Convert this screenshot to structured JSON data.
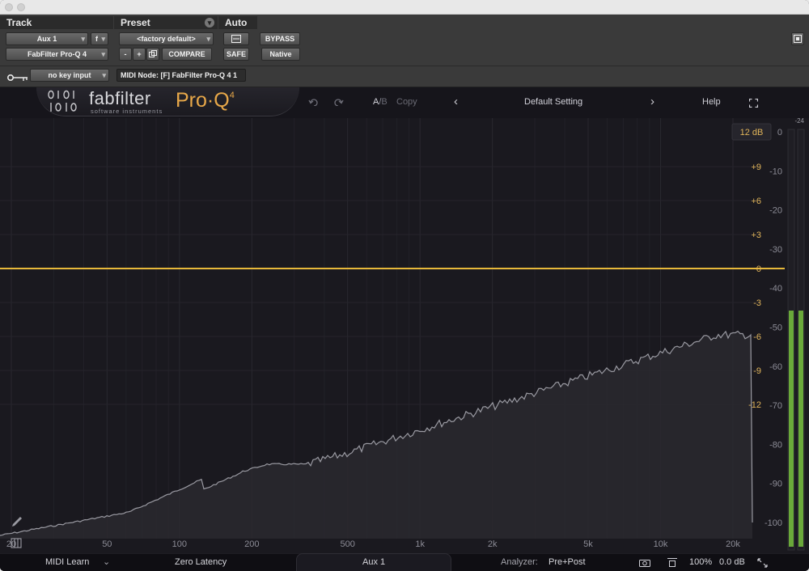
{
  "header": {
    "track_label": "Track",
    "preset_label": "Preset",
    "auto_label": "Auto",
    "track_name": "Aux 1",
    "track_func": "f",
    "insert_name": "FabFilter Pro-Q 4",
    "preset_value": "<factory default>",
    "preset_minus": "-",
    "preset_plus": "+",
    "compare": "COMPARE",
    "safe": "SAFE",
    "bypass": "BYPASS",
    "native": "Native",
    "key_input": "no key input",
    "midi_node": "MIDI Node: [F] FabFilter Pro-Q 4 1"
  },
  "plugin": {
    "brand": "fabfilter",
    "brand_sub": "software instruments",
    "product": "Pro·Q",
    "product_version": "4",
    "ab_a": "A",
    "ab_sep": "/",
    "ab_b": "B",
    "copy": "Copy",
    "preset_name": "Default Setting",
    "prev": "‹",
    "next": "›",
    "help": "Help",
    "undo_icon": "undo-icon",
    "redo_icon": "redo-icon",
    "fullscreen_icon": "fullscreen-icon"
  },
  "graph": {
    "range_button": "12 dB",
    "meter_top": "-24",
    "eq_scale": [
      "+9",
      "+6",
      "+3",
      "0",
      "-3",
      "-6",
      "-9",
      "-12"
    ],
    "db_scale": [
      "0",
      "-10",
      "-20",
      "-30",
      "-40",
      "-50",
      "-60",
      "-70",
      "-80",
      "-90",
      "-100"
    ],
    "freq_labels": [
      "20",
      "50",
      "100",
      "200",
      "500",
      "1k",
      "2k",
      "5k",
      "10k",
      "20k"
    ],
    "colors": {
      "eq_curve": "#e6b83a",
      "eq_label": "#e0b45a",
      "meter": "#6aa83a",
      "spectrum": "#9a9aa2"
    }
  },
  "footer": {
    "midi_learn": "MIDI Learn",
    "latency": "Zero Latency",
    "channel": "Aux 1",
    "analyzer_label": "Analyzer:",
    "analyzer_value": "Pre+Post",
    "zoom": "100%",
    "gain": "0.0 dB"
  }
}
